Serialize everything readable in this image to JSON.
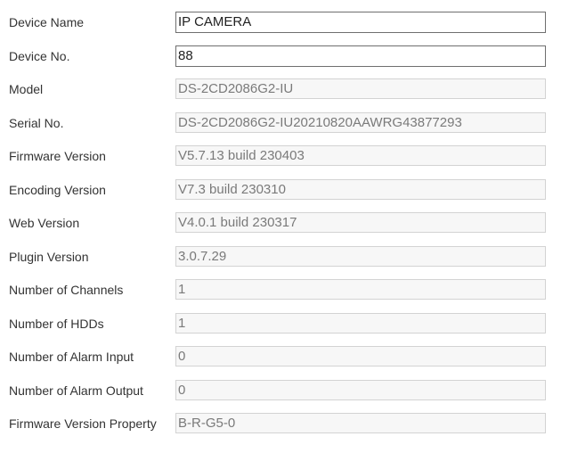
{
  "fields": [
    {
      "label": "Device Name",
      "value": "IP CAMERA",
      "editable": true
    },
    {
      "label": "Device No.",
      "value": "88",
      "editable": true
    },
    {
      "label": "Model",
      "value": "DS-2CD2086G2-IU",
      "editable": false
    },
    {
      "label": "Serial No.",
      "value": "DS-2CD2086G2-IU20210820AAWRG43877293",
      "editable": false
    },
    {
      "label": "Firmware Version",
      "value": "V5.7.13 build 230403",
      "editable": false
    },
    {
      "label": "Encoding Version",
      "value": "V7.3 build 230310",
      "editable": false
    },
    {
      "label": "Web Version",
      "value": "V4.0.1 build 230317",
      "editable": false
    },
    {
      "label": "Plugin Version",
      "value": "3.0.7.29",
      "editable": false
    },
    {
      "label": "Number of Channels",
      "value": "1",
      "editable": false
    },
    {
      "label": "Number of HDDs",
      "value": "1",
      "editable": false
    },
    {
      "label": "Number of Alarm Input",
      "value": "0",
      "editable": false
    },
    {
      "label": "Number of Alarm Output",
      "value": "0",
      "editable": false
    },
    {
      "label": "Firmware Version Property",
      "value": "B-R-G5-0",
      "editable": false
    }
  ]
}
